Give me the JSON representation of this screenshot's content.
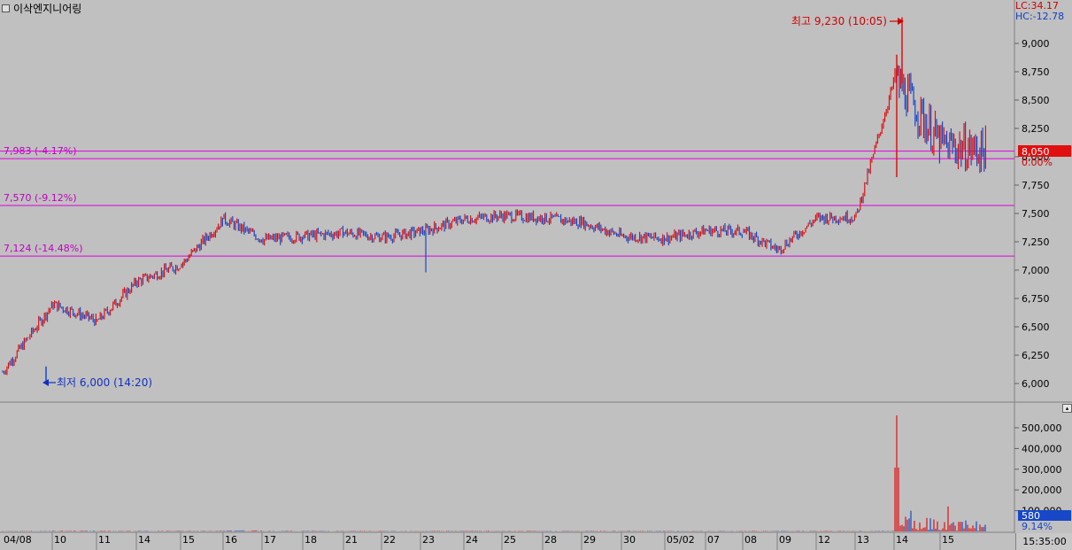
{
  "window": {
    "title": "이삭엔지니어링"
  },
  "indicators": {
    "lc": "LC:34.17",
    "hc": "HC:-12.78"
  },
  "price_axis": {
    "ticks": [
      "9,000",
      "8,750",
      "8,500",
      "8,250",
      "8,000",
      "7,750",
      "7,500",
      "7,250",
      "7,000",
      "6,750",
      "6,500",
      "6,250",
      "6,000"
    ]
  },
  "current": {
    "price": "8,050",
    "change": "0.00%"
  },
  "annotations": {
    "high": "최고 9,230 (10:05)",
    "low": "최저 6,000 (14:20)"
  },
  "levels": [
    {
      "label": "7,983 (-4.17%)",
      "price": 7983
    },
    {
      "label": "7,570 (-9.12%)",
      "price": 7570
    },
    {
      "label": "7,124 (-14.48%)",
      "price": 7124
    }
  ],
  "volume_axis": {
    "ticks": [
      "500,000",
      "400,000",
      "300,000",
      "200,000",
      "100,000"
    ]
  },
  "volume_current": {
    "value": "580",
    "pct": "9.14%"
  },
  "x_axis": {
    "dates": [
      "04/08",
      "10",
      "11",
      "14",
      "15",
      "16",
      "17",
      "18",
      "21",
      "22",
      "23",
      "24",
      "25",
      "28",
      "29",
      "30",
      "05/02",
      "07",
      "08",
      "09",
      "12",
      "13",
      "14",
      "15"
    ]
  },
  "time": "15:35:00",
  "chart_data": {
    "type": "line",
    "title": "이삭엔지니어링",
    "x": [
      "04/08",
      "10",
      "11",
      "14",
      "15",
      "16",
      "17",
      "18",
      "21",
      "22",
      "23",
      "24",
      "25",
      "28",
      "29",
      "30",
      "05/02",
      "07",
      "08",
      "09",
      "12",
      "13",
      "14",
      "15"
    ],
    "series": [
      {
        "values": [
          6100,
          6700,
          6550,
          6900,
          7050,
          7450,
          7270,
          7300,
          7330,
          7290,
          7340,
          7450,
          7480,
          7460,
          7420,
          7300,
          7280,
          7350,
          7340,
          7180,
          7460,
          7470,
          8700,
          8100
        ]
      }
    ],
    "volume": [
      2000,
      4000,
      3000,
      3000,
      3000,
      5000,
      3000,
      3000,
      2500,
      2500,
      3000,
      3000,
      2500,
      2500,
      3000,
      3500,
      2500,
      2500,
      2500,
      3000,
      3000,
      3000,
      560000,
      120000
    ],
    "ylim": [
      5900,
      9350
    ],
    "volume_ylim": [
      0,
      560000
    ],
    "high": 9230,
    "low": 6000,
    "last": 8050
  },
  "colors": {
    "up": "#e01010",
    "down": "#1848c8",
    "level_line": "#e000e0",
    "background": "#c0c0c0"
  }
}
